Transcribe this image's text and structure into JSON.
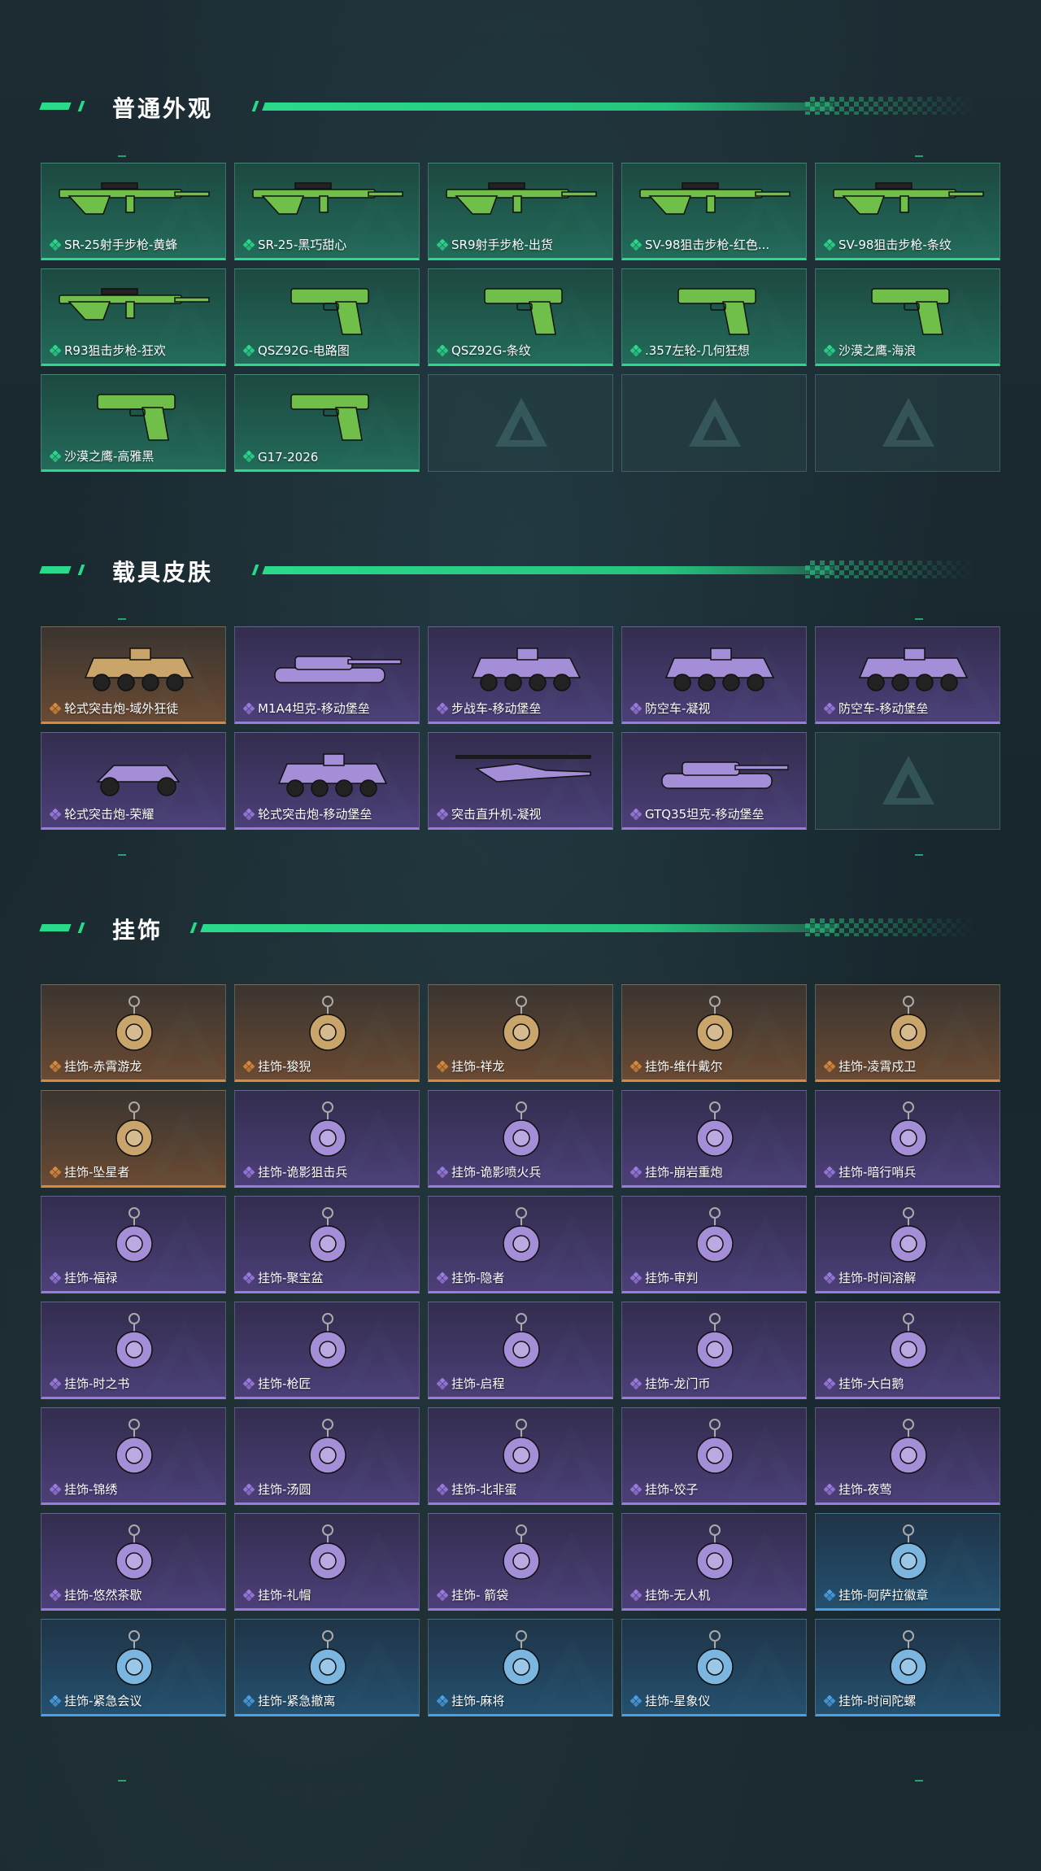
{
  "sections": {
    "skins": {
      "title": "普通外观",
      "items": [
        {
          "label": "SR-25射手步枪-黄蜂",
          "rarity": "green",
          "icon": "rifle-icon"
        },
        {
          "label": "SR-25-黑巧甜心",
          "rarity": "green",
          "icon": "rifle-icon"
        },
        {
          "label": "SR9射手步枪-出货",
          "rarity": "green",
          "icon": "rifle-icon"
        },
        {
          "label": "SV-98狙击步枪-红色...",
          "rarity": "green",
          "icon": "sniper-rifle-icon"
        },
        {
          "label": "SV-98狙击步枪-条纹",
          "rarity": "green",
          "icon": "sniper-rifle-icon"
        },
        {
          "label": "R93狙击步枪-狂欢",
          "rarity": "green",
          "icon": "sniper-rifle-icon"
        },
        {
          "label": "QSZ92G-电路图",
          "rarity": "green",
          "icon": "pistol-icon"
        },
        {
          "label": "QSZ92G-条纹",
          "rarity": "green",
          "icon": "pistol-icon"
        },
        {
          "label": ".357左轮-几何狂想",
          "rarity": "green",
          "icon": "revolver-icon"
        },
        {
          "label": "沙漠之鹰-海浪",
          "rarity": "green",
          "icon": "pistol-icon"
        },
        {
          "label": "沙漠之鹰-高雅黑",
          "rarity": "green",
          "icon": "pistol-icon"
        },
        {
          "label": "G17-2026",
          "rarity": "green",
          "icon": "pistol-icon"
        }
      ],
      "empty_slots": 3
    },
    "vehicles": {
      "title": "载具皮肤",
      "items": [
        {
          "label": "轮式突击炮-域外狂徒",
          "rarity": "orange",
          "icon": "armored-car-icon"
        },
        {
          "label": "M1A4坦克-移动堡垒",
          "rarity": "purple",
          "icon": "tank-icon"
        },
        {
          "label": "步战车-移动堡垒",
          "rarity": "purple",
          "icon": "ifv-icon"
        },
        {
          "label": "防空车-凝视",
          "rarity": "purple",
          "icon": "ifv-icon"
        },
        {
          "label": "防空车-移动堡垒",
          "rarity": "purple",
          "icon": "ifv-icon"
        },
        {
          "label": "轮式突击炮-荣耀",
          "rarity": "purple",
          "icon": "buggy-icon"
        },
        {
          "label": "轮式突击炮-移动堡垒",
          "rarity": "purple",
          "icon": "armored-car-icon"
        },
        {
          "label": "突击直升机-凝视",
          "rarity": "purple",
          "icon": "helicopter-icon"
        },
        {
          "label": "GTQ35坦克-移动堡垒",
          "rarity": "purple",
          "icon": "tank-icon"
        }
      ],
      "empty_slots": 1
    },
    "charms": {
      "title": "挂饰",
      "items": [
        {
          "label": "挂饰-赤霄游龙",
          "rarity": "orange",
          "icon": "charm-icon"
        },
        {
          "label": "挂饰-狻猊",
          "rarity": "orange",
          "icon": "charm-icon"
        },
        {
          "label": "挂饰-祥龙",
          "rarity": "orange",
          "icon": "charm-icon"
        },
        {
          "label": "挂饰-维什戴尔",
          "rarity": "orange",
          "icon": "charm-icon"
        },
        {
          "label": "挂饰-凌霄戍卫",
          "rarity": "orange",
          "icon": "charm-icon"
        },
        {
          "label": "挂饰-坠星者",
          "rarity": "orange",
          "icon": "charm-icon"
        },
        {
          "label": "挂饰-诡影狙击兵",
          "rarity": "purple",
          "icon": "charm-icon"
        },
        {
          "label": "挂饰-诡影喷火兵",
          "rarity": "purple",
          "icon": "charm-icon"
        },
        {
          "label": "挂饰-崩岩重炮",
          "rarity": "purple",
          "icon": "charm-icon"
        },
        {
          "label": "挂饰-暗行哨兵",
          "rarity": "purple",
          "icon": "charm-icon"
        },
        {
          "label": "挂饰-福禄",
          "rarity": "purple",
          "icon": "charm-icon"
        },
        {
          "label": "挂饰-聚宝盆",
          "rarity": "purple",
          "icon": "charm-icon"
        },
        {
          "label": "挂饰-隐者",
          "rarity": "purple",
          "icon": "charm-icon"
        },
        {
          "label": "挂饰-审判",
          "rarity": "purple",
          "icon": "charm-icon"
        },
        {
          "label": "挂饰-时间溶解",
          "rarity": "purple",
          "icon": "charm-icon"
        },
        {
          "label": "挂饰-时之书",
          "rarity": "purple",
          "icon": "charm-icon"
        },
        {
          "label": "挂饰-枪匠",
          "rarity": "purple",
          "icon": "charm-icon"
        },
        {
          "label": "挂饰-启程",
          "rarity": "purple",
          "icon": "charm-icon"
        },
        {
          "label": "挂饰-龙门币",
          "rarity": "purple",
          "icon": "charm-icon"
        },
        {
          "label": "挂饰-大白鹅",
          "rarity": "purple",
          "icon": "charm-icon"
        },
        {
          "label": "挂饰-锦绣",
          "rarity": "purple",
          "icon": "charm-icon"
        },
        {
          "label": "挂饰-汤圆",
          "rarity": "purple",
          "icon": "charm-icon"
        },
        {
          "label": "挂饰-北非蛋",
          "rarity": "purple",
          "icon": "charm-icon"
        },
        {
          "label": "挂饰-饺子",
          "rarity": "purple",
          "icon": "charm-icon"
        },
        {
          "label": "挂饰-夜莺",
          "rarity": "purple",
          "icon": "charm-icon"
        },
        {
          "label": "挂饰-悠然茶歇",
          "rarity": "purple",
          "icon": "charm-icon"
        },
        {
          "label": "挂饰-礼帽",
          "rarity": "purple",
          "icon": "charm-icon"
        },
        {
          "label": "挂饰- 箭袋",
          "rarity": "purple",
          "icon": "charm-icon"
        },
        {
          "label": "挂饰-无人机",
          "rarity": "purple",
          "icon": "charm-icon"
        },
        {
          "label": "挂饰-阿萨拉徽章",
          "rarity": "blue",
          "icon": "charm-icon"
        },
        {
          "label": "挂饰-紧急会议",
          "rarity": "blue",
          "icon": "charm-icon"
        },
        {
          "label": "挂饰-紧急撤离",
          "rarity": "blue",
          "icon": "charm-icon"
        },
        {
          "label": "挂饰-麻将",
          "rarity": "blue",
          "icon": "charm-icon"
        },
        {
          "label": "挂饰-星象仪",
          "rarity": "blue",
          "icon": "charm-icon"
        },
        {
          "label": "挂饰-时间陀螺",
          "rarity": "blue",
          "icon": "charm-icon"
        }
      ],
      "empty_slots": 0
    }
  },
  "colors": {
    "accent": "#2bd98a",
    "green": "#2bd98a",
    "orange": "#d98a3b",
    "purple": "#9c7be0",
    "blue": "#4b9fe6"
  }
}
